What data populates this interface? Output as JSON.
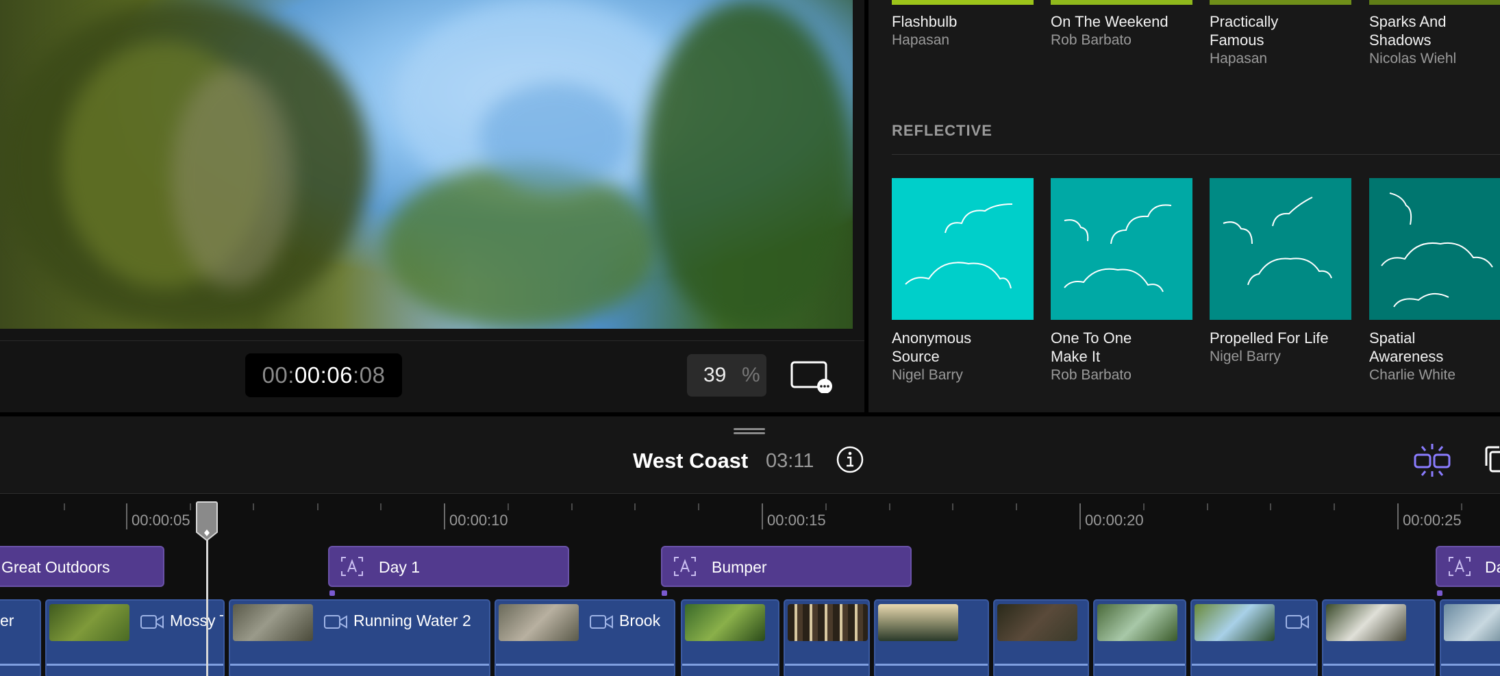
{
  "viewer": {
    "timecode_dim": "00:",
    "timecode_main": "00:06",
    "timecode_frames": ":08",
    "zoom_value": "39",
    "zoom_unit": "%"
  },
  "browser": {
    "row1": [
      {
        "title": "Flashbulb",
        "artist": "Hapasan",
        "bar_color": "#9cc41a"
      },
      {
        "title": "On The Weekend",
        "artist": "Rob Barbato",
        "bar_color": "#8fb81c"
      },
      {
        "title": "Practically Famous",
        "artist": "Hapasan",
        "bar_color": "#6f8f19"
      },
      {
        "title": "Sparks And Shadows",
        "artist": "Nicolas Wiehl",
        "bar_color": "#607e17"
      }
    ],
    "section_label": "REFLECTIVE",
    "row2": [
      {
        "title": "Anonymous Source",
        "artist": "Nigel Barry",
        "art_color": "#00cfca"
      },
      {
        "title": "One To One Make It",
        "artist": "Rob Barbato",
        "art_color": "#00a9a5"
      },
      {
        "title": "Propelled For Life",
        "artist": "Nigel Barry",
        "art_color": "#008a84"
      },
      {
        "title": "Spatial Awareness",
        "artist": "Charlie White",
        "art_color": "#00766f"
      }
    ]
  },
  "timeline": {
    "project_name": "West Coast",
    "project_duration": "03:11",
    "ruler_labels": [
      "00:00:05",
      "00:00:10",
      "00:00:15",
      "00:00:20",
      "00:00:25"
    ],
    "title_clips": [
      {
        "label": "Great Outdoors"
      },
      {
        "label": "Day 1"
      },
      {
        "label": "Bumper"
      },
      {
        "label": "Da"
      }
    ],
    "video_clips": [
      {
        "label": "er"
      },
      {
        "label": "Mossy T"
      },
      {
        "label": "Running Water 2"
      },
      {
        "label": "Brook"
      }
    ],
    "colors": {
      "title_clip": "#523a8e",
      "video_clip": "#2a4788",
      "accent_purple": "#8a7cff"
    }
  }
}
